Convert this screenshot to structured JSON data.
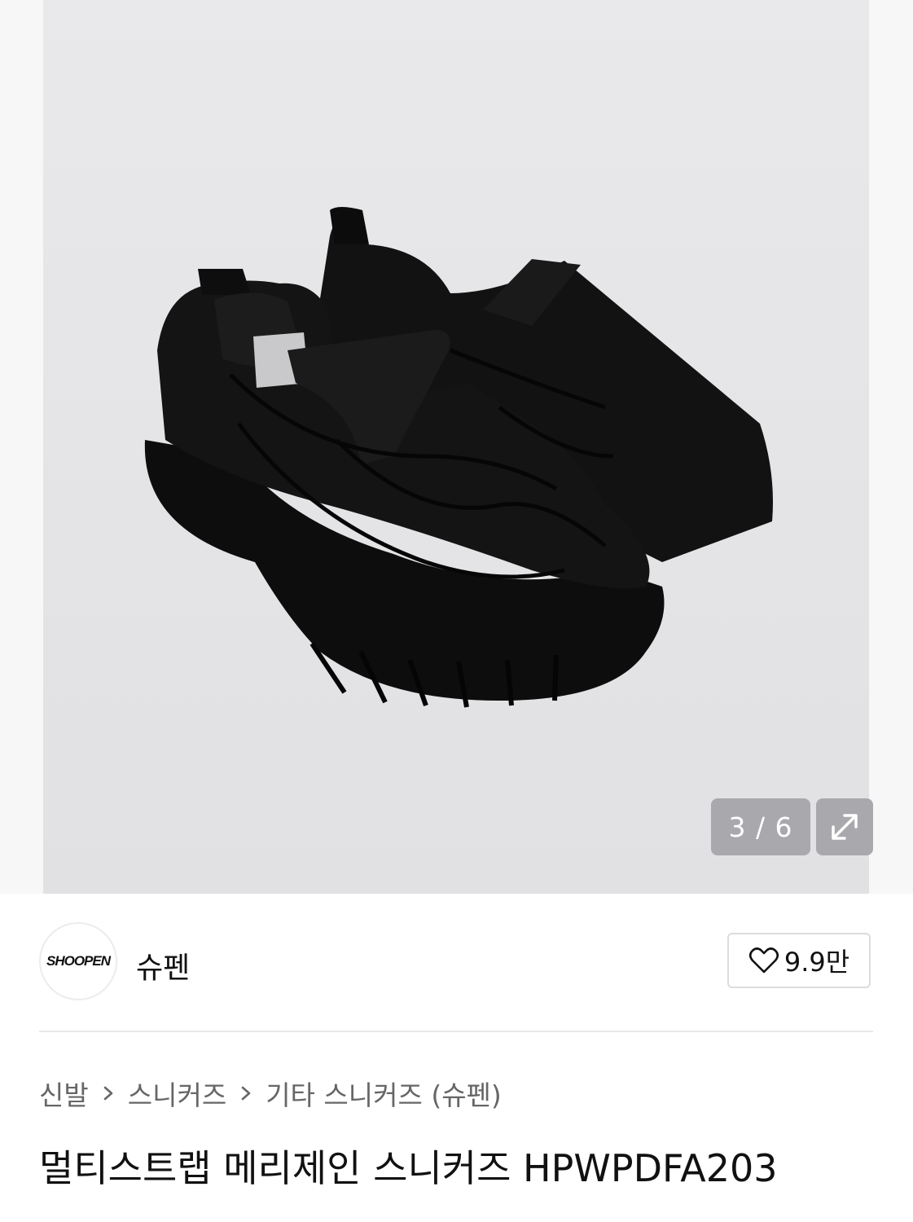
{
  "gallery": {
    "counter": "3 / 6",
    "expand_icon": "expand-icon"
  },
  "brand": {
    "logo_text": "SHOOPEN",
    "name": "슈펜"
  },
  "like": {
    "icon": "heart-icon",
    "count": "9.9만"
  },
  "breadcrumb": {
    "items": [
      "신발",
      "스니커즈",
      "기타 스니커즈 (슈펜)"
    ],
    "separator_icon": "chevron-right-icon"
  },
  "product": {
    "title": "멀티스트랩 메리제인 스니커즈 HPWPDFA203"
  }
}
